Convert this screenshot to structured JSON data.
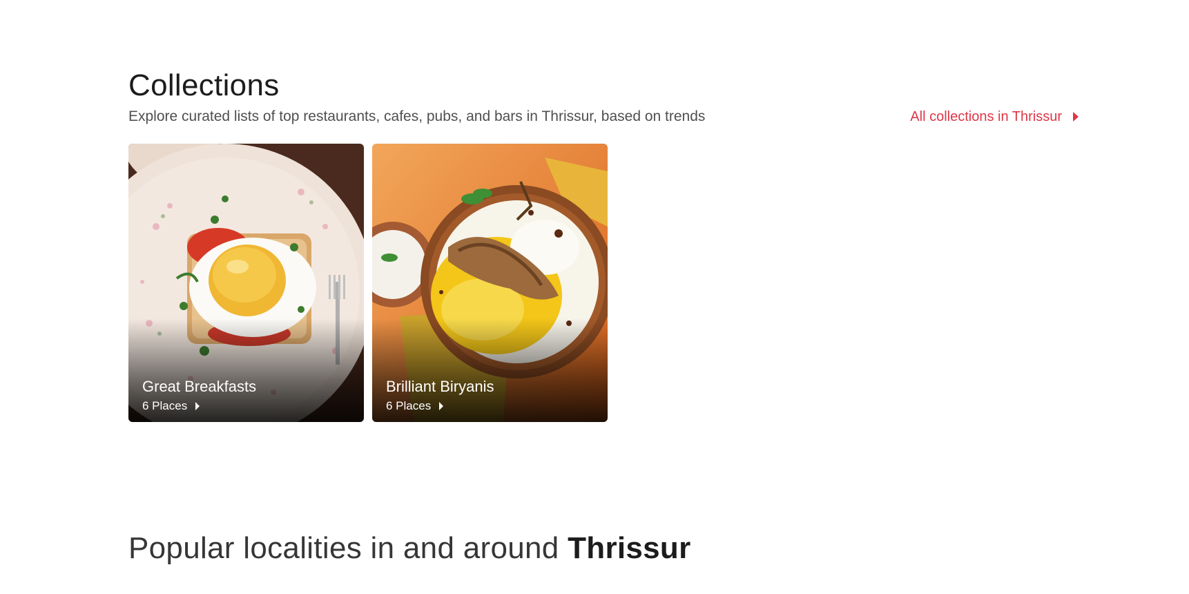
{
  "collections": {
    "title": "Collections",
    "subtitle": "Explore curated lists of top restaurants, cafes, pubs, and bars in Thrissur, based on trends",
    "all_link_label": "All collections in Thrissur",
    "accent_color": "#e03546",
    "cards": [
      {
        "title": "Great Breakfasts",
        "count": "6 Places",
        "image": "fried-egg-toast-on-floral-plate"
      },
      {
        "title": "Brilliant Biryanis",
        "count": "6 Places",
        "image": "chicken-biryani-bowl-on-orange"
      }
    ]
  },
  "localities": {
    "heading_prefix": "Popular localities in and around",
    "heading_city": "Thrissur"
  }
}
